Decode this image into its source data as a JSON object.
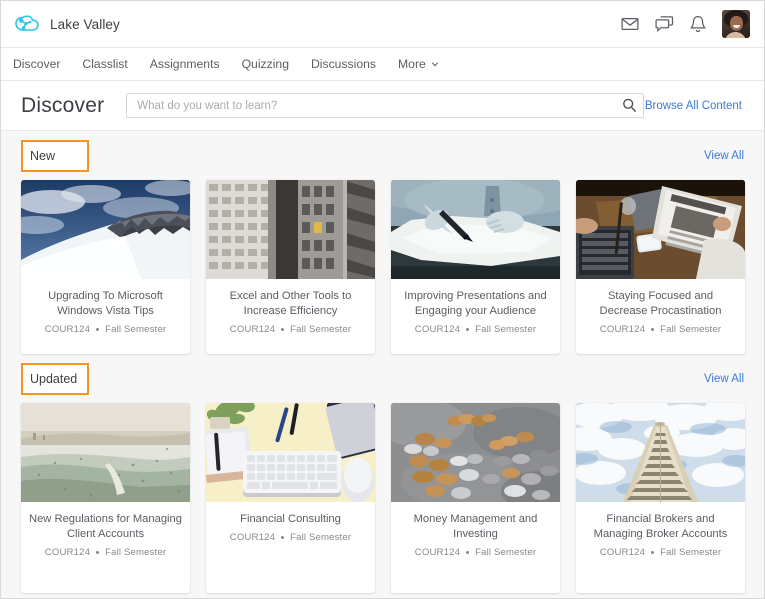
{
  "brand": {
    "name": "Lake Valley",
    "logo_color": "#2bc4e8",
    "logo_icon": "cloud-network-logo"
  },
  "topbar": {
    "icons": [
      {
        "name": "email-icon",
        "glyph": "envelope"
      },
      {
        "name": "messages-icon",
        "glyph": "chat-bubbles"
      },
      {
        "name": "notifications-icon",
        "glyph": "bell"
      }
    ],
    "avatar": {
      "name": "user-avatar",
      "alt": "User profile photo"
    }
  },
  "nav": {
    "items": [
      {
        "label": "Discover",
        "has_caret": false
      },
      {
        "label": "Classlist",
        "has_caret": false
      },
      {
        "label": "Assignments",
        "has_caret": false
      },
      {
        "label": "Quizzing",
        "has_caret": false
      },
      {
        "label": "Discussions",
        "has_caret": false
      },
      {
        "label": "More",
        "has_caret": true
      }
    ]
  },
  "discover": {
    "title": "Discover",
    "search_placeholder": "What do you want to learn?",
    "search_value": "",
    "search_icon": "search-icon",
    "browse_all_label": "Browse All Content",
    "link_color": "#3c78d8"
  },
  "sections": [
    {
      "title": "New",
      "highlighted": true,
      "highlight_color": "#f29522",
      "view_all_label": "View All",
      "cards": [
        {
          "title": "Upgrading To Microsoft Windows Vista Tips",
          "course_code": "COUR124",
          "term": "Fall Semester",
          "image": "snowy-mountain-peak-blue-sky"
        },
        {
          "title": "Excel and Other Tools to Increase Efficiency",
          "course_code": "COUR124",
          "term": "Fall Semester",
          "image": "office-building-facades"
        },
        {
          "title": "Improving Presentations and Engaging your Audience",
          "course_code": "COUR124",
          "term": "Fall Semester",
          "image": "hand-writing-on-paper-with-pen"
        },
        {
          "title": "Staying Focused and Decrease Procastination",
          "course_code": "COUR124",
          "term": "Fall Semester",
          "image": "person-reading-business-newspaper-at-desk"
        }
      ]
    },
    {
      "title": "Updated",
      "highlighted": true,
      "highlight_color": "#f29522",
      "view_all_label": "View All",
      "cards": [
        {
          "title": "New Regulations for Managing Client Accounts",
          "course_code": "COUR124",
          "term": "Fall Semester",
          "image": "faded-coastal-landscape"
        },
        {
          "title": "Financial Consulting",
          "course_code": "COUR124",
          "term": "Fall Semester",
          "image": "desk-flatlay-keyboard-mouse-plant"
        },
        {
          "title": "Money Management and Investing",
          "course_code": "COUR124",
          "term": "Fall Semester",
          "image": "coins-scattered-on-gray-surface"
        },
        {
          "title": "Financial Brokers and Managing Broker Accounts",
          "course_code": "COUR124",
          "term": "Fall Semester",
          "image": "skyscraper-upward-view-clouds"
        }
      ]
    }
  ]
}
